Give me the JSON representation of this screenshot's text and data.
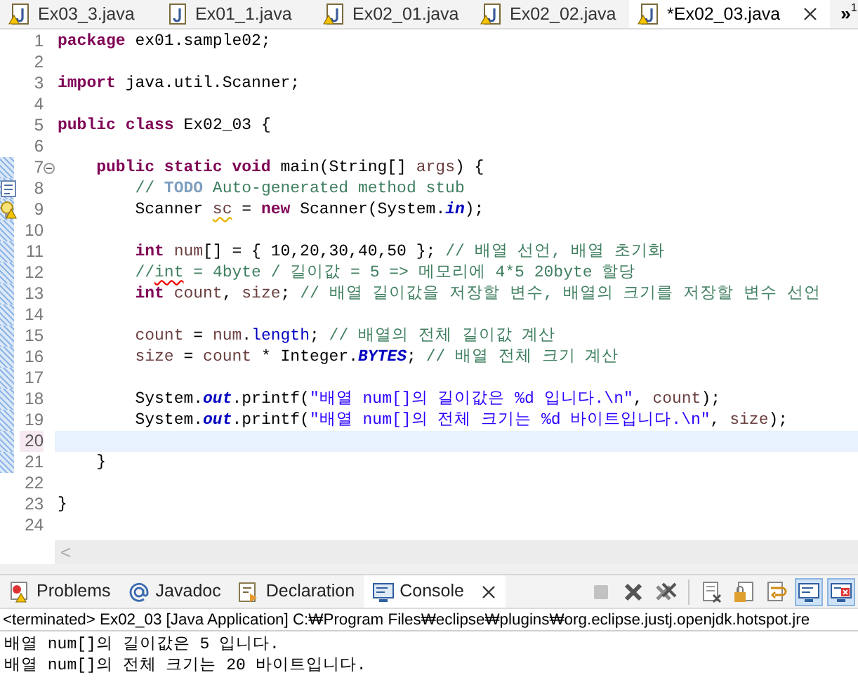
{
  "editor_tabs": [
    {
      "label": "Ex03_3.java",
      "warning": true,
      "selected": false
    },
    {
      "label": "Ex01_1.java",
      "warning": false,
      "selected": false
    },
    {
      "label": "Ex02_01.java",
      "warning": true,
      "selected": false
    },
    {
      "label": "Ex02_02.java",
      "warning": true,
      "selected": false
    },
    {
      "label": "*Ex02_03.java",
      "warning": true,
      "selected": true
    }
  ],
  "tab_overflow": {
    "glyph": "»",
    "count": "1"
  },
  "code_lines": [
    {
      "number": "1",
      "changed": false,
      "current": false,
      "tokens": [
        {
          "kind": "keyword",
          "text": "package"
        },
        {
          "kind": "plain",
          "text": " ex01.sample02;"
        }
      ]
    },
    {
      "number": "2",
      "changed": false,
      "current": false
    },
    {
      "number": "3",
      "changed": false,
      "current": false,
      "tokens": [
        {
          "kind": "keyword",
          "text": "import"
        },
        {
          "kind": "plain",
          "text": " java.util.Scanner;"
        }
      ]
    },
    {
      "number": "4",
      "changed": false,
      "current": false
    },
    {
      "number": "5",
      "changed": false,
      "current": false,
      "tokens": [
        {
          "kind": "keyword",
          "text": "public"
        },
        {
          "kind": "keyword",
          "text": " class"
        },
        {
          "kind": "plain",
          "text": " Ex02_03 {"
        }
      ]
    },
    {
      "number": "6",
      "changed": false,
      "current": false
    },
    {
      "number": "7",
      "changed": true,
      "current": false,
      "foldable": true,
      "tokens": [
        {
          "kind": "keyword",
          "text": "    public"
        },
        {
          "kind": "keyword",
          "text": " static"
        },
        {
          "kind": "keyword",
          "text": " void"
        },
        {
          "kind": "plain",
          "text": " main(String[] "
        },
        {
          "kind": "variable",
          "text": "args"
        },
        {
          "kind": "plain",
          "text": ") {"
        }
      ]
    },
    {
      "number": "8",
      "changed": true,
      "current": false,
      "task": true,
      "tokens": [
        {
          "kind": "comment",
          "text": "        // "
        },
        {
          "kind": "todo",
          "text": "TODO"
        },
        {
          "kind": "comment",
          "text": " Auto-generated method stub"
        }
      ]
    },
    {
      "number": "9",
      "changed": true,
      "current": false,
      "warning": true,
      "tokens": [
        {
          "kind": "plain",
          "text": "        Scanner "
        },
        {
          "kind": "variable",
          "text": "sc",
          "warning": true
        },
        {
          "kind": "plain",
          "text": " = "
        },
        {
          "kind": "keyword",
          "text": "new"
        },
        {
          "kind": "plain",
          "text": " Scanner(System."
        },
        {
          "kind": "static",
          "text": "in"
        },
        {
          "kind": "plain",
          "text": ");"
        }
      ]
    },
    {
      "number": "10",
      "changed": true,
      "current": false
    },
    {
      "number": "11",
      "changed": true,
      "current": false,
      "tokens": [
        {
          "kind": "keyword",
          "text": "        int"
        },
        {
          "kind": "variable",
          "text": " num"
        },
        {
          "kind": "plain",
          "text": "[] = { 10,20,30,40,50 }; "
        },
        {
          "kind": "comment",
          "text": "// 배열 선언, 배열 초기화"
        }
      ]
    },
    {
      "number": "12",
      "changed": true,
      "current": false,
      "tokens": [
        {
          "kind": "comment",
          "text": "        //"
        },
        {
          "kind": "comment",
          "text": "int",
          "spelling_error": true
        },
        {
          "kind": "comment",
          "text": " = 4byte / 길이값 = 5 => 메모리에 4*5 20byte 할당"
        }
      ]
    },
    {
      "number": "13",
      "changed": true,
      "current": false,
      "tokens": [
        {
          "kind": "keyword",
          "text": "        int"
        },
        {
          "kind": "variable",
          "text": " count"
        },
        {
          "kind": "plain",
          "text": ", "
        },
        {
          "kind": "variable",
          "text": "size"
        },
        {
          "kind": "plain",
          "text": "; "
        },
        {
          "kind": "comment",
          "text": "// 배열 길이값을 저장할 변수, 배열의 크기를 저장할 변수 선언"
        }
      ]
    },
    {
      "number": "14",
      "changed": true,
      "current": false
    },
    {
      "number": "15",
      "changed": true,
      "current": false,
      "tokens": [
        {
          "kind": "variable",
          "text": "        count"
        },
        {
          "kind": "plain",
          "text": " = "
        },
        {
          "kind": "variable",
          "text": "num"
        },
        {
          "kind": "plain",
          "text": "."
        },
        {
          "kind": "field",
          "text": "length"
        },
        {
          "kind": "plain",
          "text": "; "
        },
        {
          "kind": "comment",
          "text": "// 배열의 전체 길이값 계산"
        }
      ]
    },
    {
      "number": "16",
      "changed": true,
      "current": false,
      "tokens": [
        {
          "kind": "variable",
          "text": "        size"
        },
        {
          "kind": "plain",
          "text": " = "
        },
        {
          "kind": "variable",
          "text": "count"
        },
        {
          "kind": "plain",
          "text": " * Integer."
        },
        {
          "kind": "static",
          "text": "BYTES"
        },
        {
          "kind": "plain",
          "text": "; "
        },
        {
          "kind": "comment",
          "text": "// 배열 전체 크기 계산"
        }
      ]
    },
    {
      "number": "17",
      "changed": true,
      "current": false
    },
    {
      "number": "18",
      "changed": true,
      "current": false,
      "tokens": [
        {
          "kind": "plain",
          "text": "        System."
        },
        {
          "kind": "static",
          "text": "out"
        },
        {
          "kind": "plain",
          "text": ".printf("
        },
        {
          "kind": "string",
          "text": "\"배열 num[]의 길이값은 %d 입니다.\\n\""
        },
        {
          "kind": "plain",
          "text": ", "
        },
        {
          "kind": "variable",
          "text": "count"
        },
        {
          "kind": "plain",
          "text": ");"
        }
      ]
    },
    {
      "number": "19",
      "changed": true,
      "current": false,
      "tokens": [
        {
          "kind": "plain",
          "text": "        System."
        },
        {
          "kind": "static",
          "text": "out"
        },
        {
          "kind": "plain",
          "text": ".printf("
        },
        {
          "kind": "string",
          "text": "\"배열 num[]의 전체 크기는 %d 바이트입니다.\\n\""
        },
        {
          "kind": "plain",
          "text": ", "
        },
        {
          "kind": "variable",
          "text": "size"
        },
        {
          "kind": "plain",
          "text": ");"
        }
      ]
    },
    {
      "number": "20",
      "changed": true,
      "current": true
    },
    {
      "number": "21",
      "changed": true,
      "current": false,
      "tokens": [
        {
          "kind": "plain",
          "text": "    }"
        }
      ]
    },
    {
      "number": "22",
      "changed": false,
      "current": false
    },
    {
      "number": "23",
      "changed": false,
      "current": false,
      "tokens": [
        {
          "kind": "plain",
          "text": "}"
        }
      ]
    },
    {
      "number": "24",
      "changed": false,
      "current": false
    }
  ],
  "scrollbar_arrow": "<",
  "panel_tabs": [
    {
      "kind": "problems",
      "label": "Problems",
      "selected": false
    },
    {
      "kind": "javadoc",
      "label": "Javadoc",
      "selected": false
    },
    {
      "kind": "declaration",
      "label": "Declaration",
      "selected": false
    },
    {
      "kind": "console",
      "label": "Console",
      "selected": true
    }
  ],
  "console_toolbar": [
    {
      "kind": "terminate",
      "disabled": true,
      "pressed": false
    },
    {
      "kind": "remove",
      "disabled": false,
      "pressed": false
    },
    {
      "kind": "remove-all",
      "disabled": false,
      "pressed": false
    },
    {
      "kind": "separator"
    },
    {
      "kind": "clear",
      "disabled": false,
      "pressed": false
    },
    {
      "kind": "scroll-lock",
      "disabled": false,
      "pressed": false
    },
    {
      "kind": "word-wrap",
      "disabled": false,
      "pressed": false
    },
    {
      "kind": "show-out",
      "disabled": false,
      "pressed": true
    },
    {
      "kind": "show-err",
      "disabled": false,
      "pressed": true
    }
  ],
  "console_header": "<terminated> Ex02_03 [Java Application] C:₩Program Files₩eclipse₩plugins₩org.eclipse.justj.openjdk.hotspot.jre",
  "console_output": [
    "배열 num[]의 길이값은 5 입니다.",
    "배열 num[]의 전체 크기는 20 바이트입니다."
  ]
}
